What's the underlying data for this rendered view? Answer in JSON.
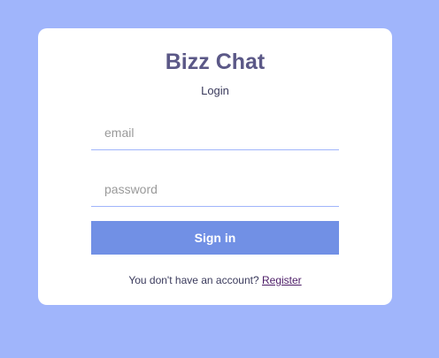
{
  "app": {
    "title": "Bizz Chat",
    "subtitle": "Login"
  },
  "form": {
    "email_placeholder": "email",
    "email_value": "",
    "password_placeholder": "password",
    "password_value": "",
    "submit_label": "Sign in"
  },
  "footer": {
    "prompt": "You don't have an account?",
    "register_label": "Register"
  },
  "colors": {
    "background": "#a0b5fb",
    "accent": "#7190e5",
    "title": "#5b5887",
    "link": "#4b1b66"
  }
}
